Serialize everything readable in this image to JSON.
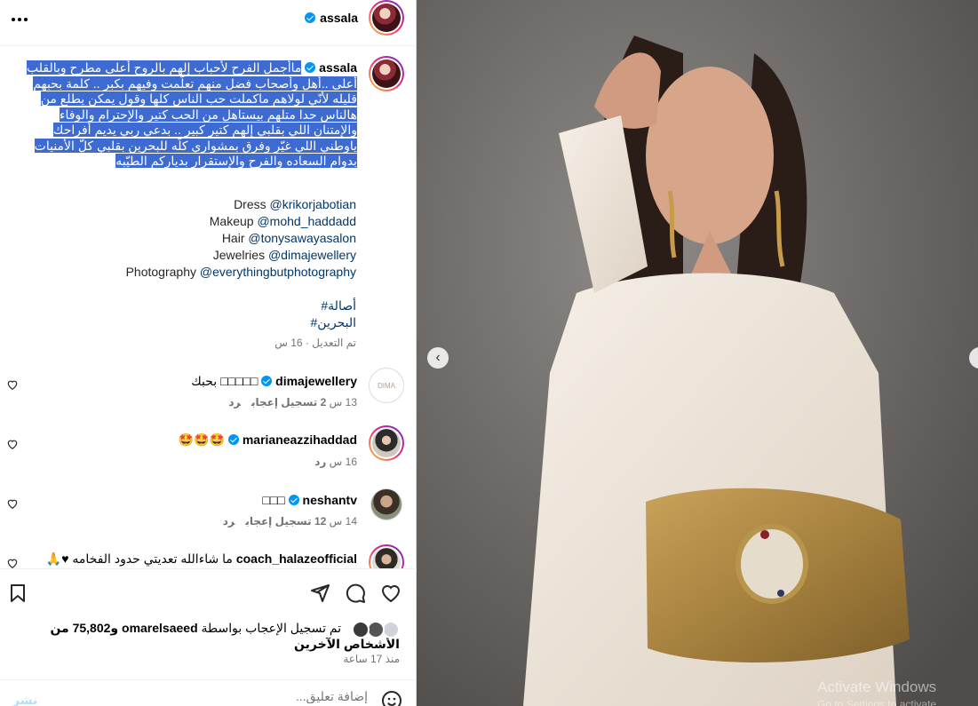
{
  "header": {
    "username": "assala"
  },
  "caption": {
    "username": "assala",
    "lines": [
      "ماأجمل الفرح لأحباب إلهم بالروح أعلى مطرح وبالقلب",
      "أعلى ..أهل وأصحاب فضل منهم تعلّمت وفيهم بكبر .. كلمة بحبهم",
      "قليله لأنّي لولاهم ماكملت حب الناس كلها وقول يمكن يطلع من",
      "هالناس حدا متلهم بيستاهل من الحب كتير والإحترام والوفاء",
      "والإمتنان اللي بقلبي إلهم كتير كبير .. بدعي ربي يديم أفراحك",
      "ياوطني اللي غيّر وفرق بمشواري كلّه للبحرين بقلبي كلّ الأمنيات",
      "بدوام السعاده والفرح والإستقرار بدياركم الطيّبه"
    ]
  },
  "credits": [
    {
      "label": "Dress",
      "handle": "@krikorjabotian"
    },
    {
      "label": "Makeup",
      "handle": "@mohd_haddadd"
    },
    {
      "label": "Hair",
      "handle": "@tonysawayasalon"
    },
    {
      "label": "Jewelries",
      "handle": "@dimajewellery"
    },
    {
      "label": "Photography",
      "handle": "@everythingbutphotography"
    }
  ],
  "hashtags": [
    "#أصالة",
    "#البحرين"
  ],
  "edited": "تم التعديل · 16 س",
  "comments": [
    {
      "username": "dimajewellery",
      "text": "□□□□□ بحبك",
      "time": "13 س",
      "likes": "2 تسجيل إعجاب",
      "reply": "رد"
    },
    {
      "username": "marianeazzihaddad",
      "text": "🤩🤩🤩",
      "time": "16 س",
      "likes": "",
      "reply": "رد"
    },
    {
      "username": "neshantv",
      "text": "□□□",
      "time": "14 س",
      "likes": "12 تسجيل إعجاب",
      "reply": "رد"
    },
    {
      "username": "coach_halazeofficial",
      "text": "ما شاءالله تعديتي حدود الفخامه ♥🙏",
      "time": "",
      "likes": "",
      "reply": ""
    }
  ],
  "likes": {
    "prefix": "تم تسجيل الإعجاب بواسطة",
    "user": "omarelsaeed",
    "suffix": "و75,802 من الأشخاص الآخرين"
  },
  "time_ago": "منذ 17 ساعة",
  "comment_input": {
    "placeholder": "إضافة تعليق..."
  },
  "post_label": "نشر",
  "watermark": {
    "line1": "Activate Windows",
    "line2": "Go to Settings to activate Windows."
  },
  "colors": {
    "selection": "#3d6bd1",
    "link": "#00376b",
    "verified": "#0095f6"
  }
}
